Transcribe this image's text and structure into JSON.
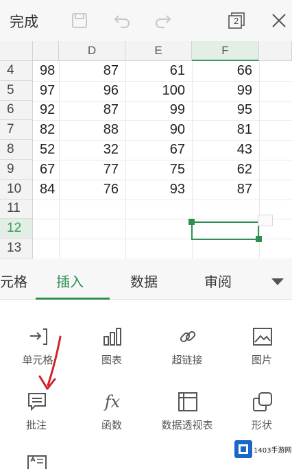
{
  "toolbar": {
    "done_label": "完成",
    "window_count": "2"
  },
  "sheet": {
    "columns": [
      "",
      "D",
      "E",
      "F",
      ""
    ],
    "rows": [
      {
        "num": "4",
        "c": "98",
        "d": "87",
        "e": "61",
        "f": "66"
      },
      {
        "num": "5",
        "c": "97",
        "d": "96",
        "e": "100",
        "f": "99"
      },
      {
        "num": "6",
        "c": "92",
        "d": "87",
        "e": "99",
        "f": "95"
      },
      {
        "num": "7",
        "c": "82",
        "d": "88",
        "e": "90",
        "f": "81"
      },
      {
        "num": "8",
        "c": "52",
        "d": "32",
        "e": "67",
        "f": "43"
      },
      {
        "num": "9",
        "c": "67",
        "d": "77",
        "e": "75",
        "f": "62"
      },
      {
        "num": "10",
        "c": "84",
        "d": "76",
        "e": "93",
        "f": "87"
      },
      {
        "num": "11",
        "c": "",
        "d": "",
        "e": "",
        "f": ""
      },
      {
        "num": "12",
        "c": "",
        "d": "",
        "e": "",
        "f": ""
      },
      {
        "num": "13",
        "c": "",
        "d": "",
        "e": "",
        "f": ""
      }
    ],
    "selected_row": "12",
    "selected_column": "F"
  },
  "tabs": [
    {
      "label": "元格",
      "active": false
    },
    {
      "label": "插入",
      "active": true
    },
    {
      "label": "数据",
      "active": false
    },
    {
      "label": "审阅",
      "active": false
    }
  ],
  "insert_tools": [
    {
      "label": "单元格",
      "icon": "insert-cell-icon"
    },
    {
      "label": "图表",
      "icon": "chart-icon"
    },
    {
      "label": "超链接",
      "icon": "link-icon"
    },
    {
      "label": "图片",
      "icon": "picture-icon"
    },
    {
      "label": "批注",
      "icon": "comment-icon"
    },
    {
      "label": "函数",
      "icon": "function-icon"
    },
    {
      "label": "数据透视表",
      "icon": "pivot-table-icon"
    },
    {
      "label": "形状",
      "icon": "shape-icon"
    }
  ],
  "watermark": {
    "text": "1403手游网"
  },
  "colors": {
    "accent": "#2f8f50",
    "annotation_arrow": "#d0242a"
  }
}
